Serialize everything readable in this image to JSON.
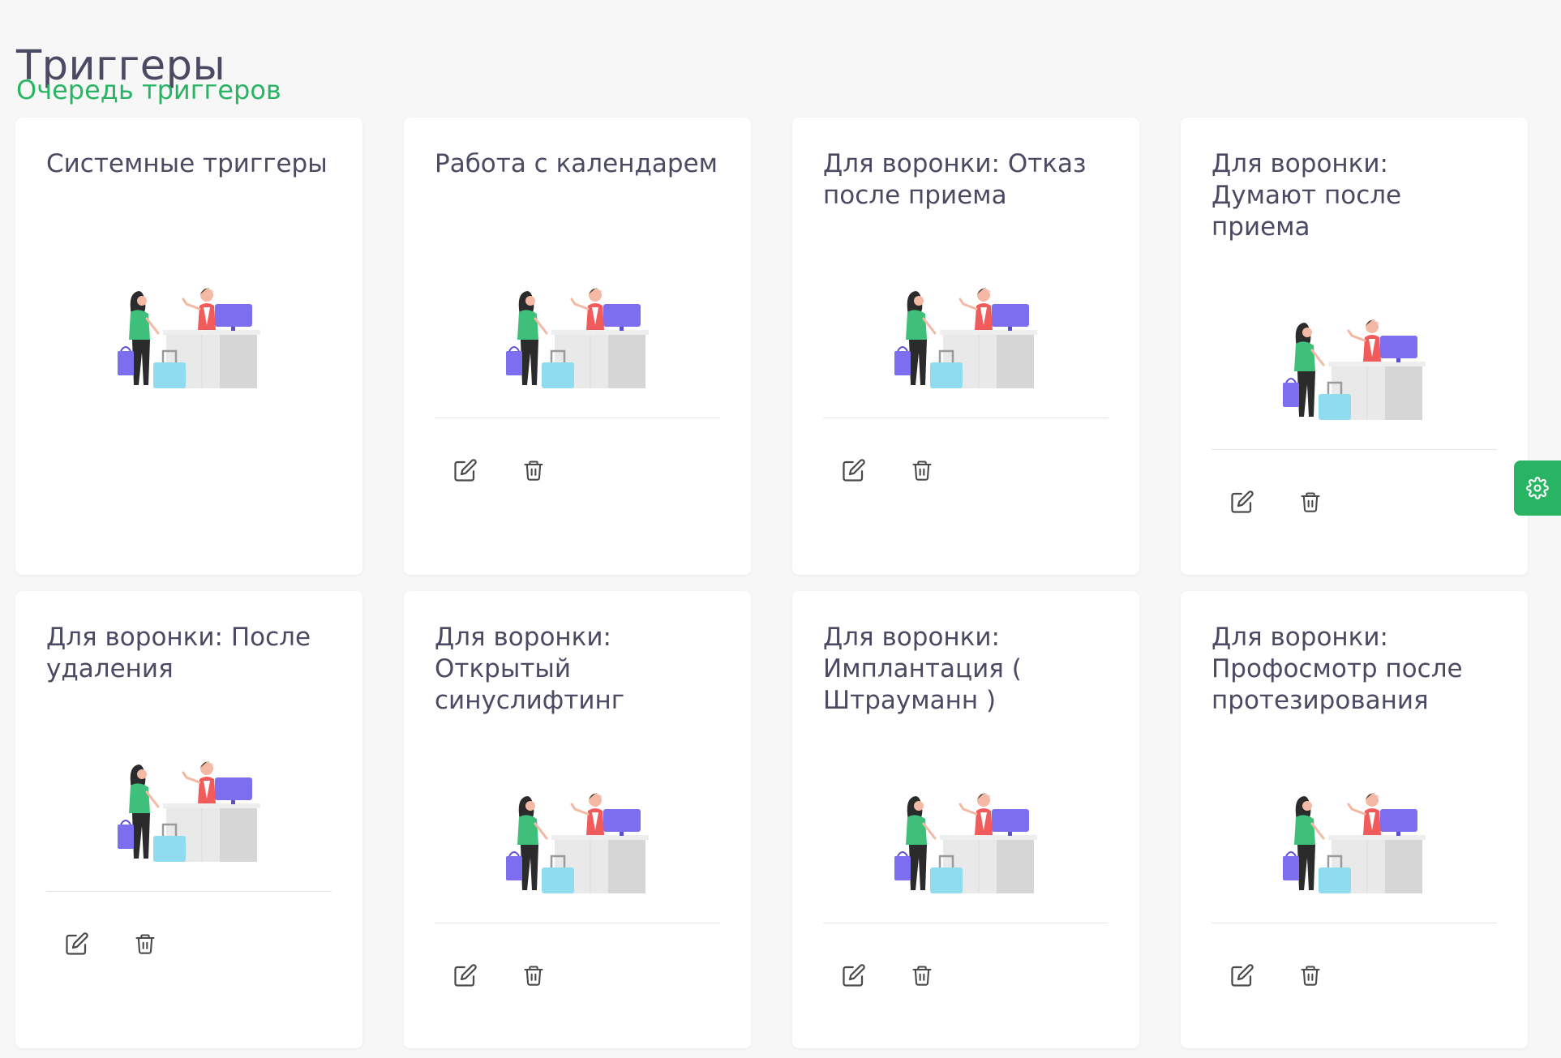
{
  "header": {
    "title": "Триггеры",
    "queue_link": "Очередь триггеров"
  },
  "colors": {
    "accent": "#28b463",
    "text": "#4b4a63",
    "background": "#f7f7f8"
  },
  "cards": [
    {
      "title": "Системные триггеры",
      "has_actions": false
    },
    {
      "title": "Работа с календарем",
      "has_actions": true
    },
    {
      "title": "Для воронки: Отказ после приема",
      "has_actions": true
    },
    {
      "title": "Для воронки: Думают после приема",
      "has_actions": true
    },
    {
      "title": "Для воронки: После удаления",
      "has_actions": true
    },
    {
      "title": "Для воронки: Открытый синуслифтинг",
      "has_actions": true
    },
    {
      "title": "Для воронки: Имплантация ( Штрауманн )",
      "has_actions": true
    },
    {
      "title": "Для воронки: Профосмотр после протезирования",
      "has_actions": true
    }
  ],
  "icons": {
    "edit": "edit-icon",
    "delete": "trash-icon",
    "settings": "gear-icon",
    "illustration": "reception-illustration"
  }
}
